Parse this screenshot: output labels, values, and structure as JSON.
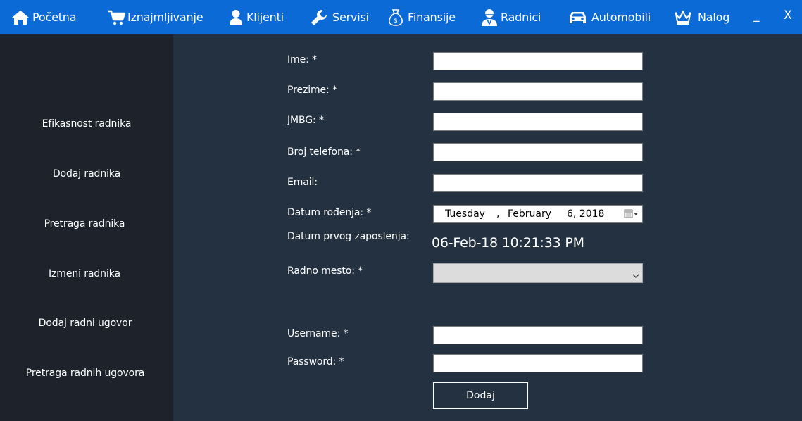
{
  "nav": {
    "items": [
      {
        "label": "Početna",
        "icon": "home-icon"
      },
      {
        "label": "Iznajmljivanje",
        "icon": "cart-icon"
      },
      {
        "label": "Klijenti",
        "icon": "user-icon"
      },
      {
        "label": "Servisi",
        "icon": "wrench-icon"
      },
      {
        "label": "Finansije",
        "icon": "money-bag-icon"
      },
      {
        "label": "Radnici",
        "icon": "worker-icon"
      },
      {
        "label": "Automobili",
        "icon": "car-icon"
      },
      {
        "label": "Nalog",
        "icon": "crown-icon"
      }
    ],
    "minimize_label": "_",
    "close_label": "X",
    "bar_color": "#0c6ad6"
  },
  "sidebar": {
    "items": [
      {
        "label": "Efikasnost radnika"
      },
      {
        "label": "Dodaj radnika"
      },
      {
        "label": "Pretraga radnika"
      },
      {
        "label": "Izmeni radnika"
      },
      {
        "label": "Dodaj radni ugovor"
      },
      {
        "label": "Pretraga radnih ugovora"
      }
    ]
  },
  "form": {
    "ime_label": "Ime: *",
    "ime_value": "",
    "prezime_label": "Prezime: *",
    "prezime_value": "",
    "jmbg_label": "JMBG: *",
    "jmbg_value": "",
    "telefon_label": "Broj telefona: *",
    "telefon_value": "",
    "email_label": "Email:",
    "email_value": "",
    "datum_rodjenja_label": "Datum rođenja:  *",
    "datum_rodjenja": {
      "weekday": "Tuesday",
      "comma": ",",
      "month": "February",
      "day_year": "6, 2018"
    },
    "datum_zaposlenja_label": "Datum prvog zaposlenja:",
    "datum_zaposlenja_value": "06-Feb-18 10:21:33 PM",
    "radno_mesto_label": "Radno mesto: *",
    "radno_mesto_value": "",
    "username_label": "Username: *",
    "username_value": "",
    "password_label": "Password: *",
    "password_value": "",
    "submit_label": "Dodaj"
  }
}
